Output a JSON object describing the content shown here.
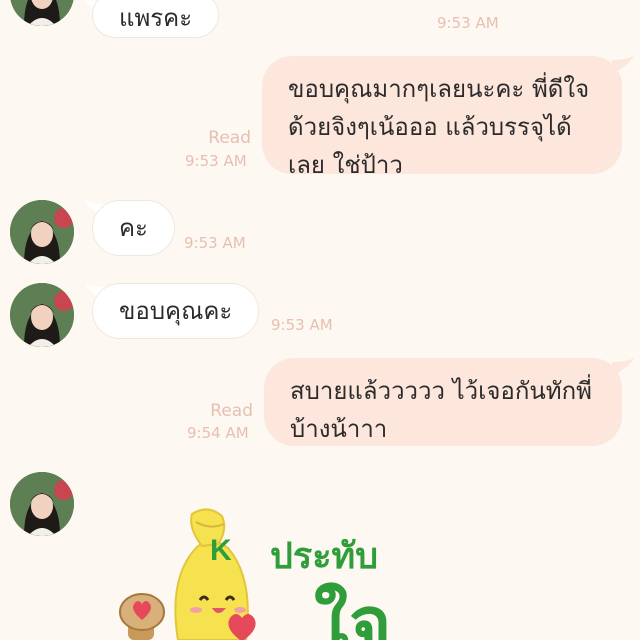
{
  "messages": [
    {
      "text": "แพรคะ",
      "time": "9:53 AM"
    },
    {
      "text": "ขอบคุณมากๆเลยนะคะ พี่ดีใจ ด้วยจิงๆเน้อออ แล้วบรรจุได้ เลย ใช่ป้าว",
      "lines": [
        "ขอบคุณมากๆเลยนะคะ พี่ดีใจ",
        "ด้วยจิงๆเน้อออ แล้วบรรจุได้",
        "เลย ใช่ป้าว"
      ],
      "read": "Read",
      "time": "9:53 AM"
    },
    {
      "text": "คะ",
      "time": "9:53 AM"
    },
    {
      "text": "ขอบคุณคะ",
      "time": "9:53 AM"
    },
    {
      "lines": [
        "สบายแล้ววววว ไว้เจอกันทักพี่",
        "บ้างน้าาา"
      ],
      "read": "Read",
      "time": "9:54 AM"
    }
  ],
  "sticker": {
    "text_top": "ประทับ",
    "text_bottom": "ใจ",
    "icon": "k-mascot-sticker"
  },
  "colors": {
    "background": "#fdf8f1",
    "incoming_bubble": "#ffffff",
    "outgoing_bubble": "#fde6dc",
    "timestamp": "#e7bfb2",
    "sticker_green": "#2f9e3a"
  }
}
